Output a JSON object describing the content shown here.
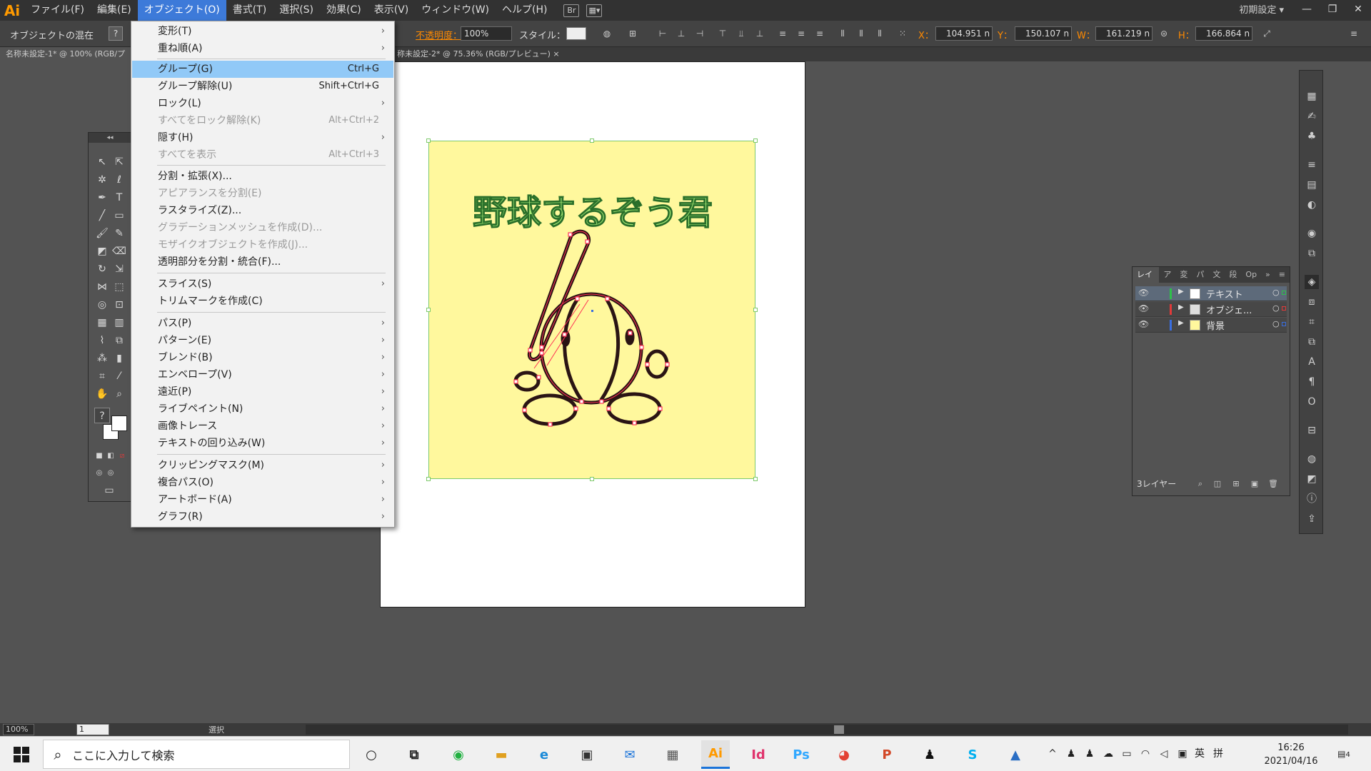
{
  "app": {
    "logo": "Ai",
    "workspace": "初期設定"
  },
  "menubar": {
    "items": [
      "ファイル(F)",
      "編集(E)",
      "オブジェクト(O)",
      "書式(T)",
      "選択(S)",
      "効果(C)",
      "表示(V)",
      "ウィンドウ(W)",
      "ヘルプ(H)"
    ],
    "active_index": 2
  },
  "window": {
    "minimize": "—",
    "restore": "❐",
    "close": "✕"
  },
  "control_bar": {
    "mixed_label": "オブジェクトの混在",
    "help": "?",
    "opacity_label": "不透明度：",
    "opacity_value": "100%",
    "style_label": "スタイル：",
    "x_label": "X：",
    "x_value": "104.951 n",
    "y_label": "Y：",
    "y_value": "150.107 n",
    "w_label": "W：",
    "w_value": "161.219 n",
    "h_label": "H：",
    "h_value": "166.864 n"
  },
  "tabs": [
    {
      "label": "名称未設定-1* @ 100% (RGB/プ"
    },
    {
      "label": "称未設定-2* @ 75.36% (RGB/プレビュー)  ×"
    }
  ],
  "artwork": {
    "title": "野球するぞう君",
    "colors": {
      "background": "#fff89d",
      "title_fill": "#a8eb77",
      "title_stroke": "#2a6f2a",
      "outline": "#2a1414",
      "path_points": "#ff3355",
      "selection": "#7ec96c"
    }
  },
  "object_menu": {
    "items": [
      {
        "label": "変形(T)",
        "shortcut": "",
        "submenu": true,
        "disabled": false
      },
      {
        "label": "重ね順(A)",
        "shortcut": "",
        "submenu": true,
        "disabled": false
      },
      {
        "label": "グループ(G)",
        "shortcut": "Ctrl+G",
        "submenu": false,
        "disabled": false,
        "highlighted": true
      },
      {
        "label": "グループ解除(U)",
        "shortcut": "Shift+Ctrl+G",
        "submenu": false,
        "disabled": false
      },
      {
        "label": "ロック(L)",
        "shortcut": "",
        "submenu": true,
        "disabled": false
      },
      {
        "label": "すべてをロック解除(K)",
        "shortcut": "Alt+Ctrl+2",
        "submenu": false,
        "disabled": true
      },
      {
        "label": "隠す(H)",
        "shortcut": "",
        "submenu": true,
        "disabled": false
      },
      {
        "label": "すべてを表示",
        "shortcut": "Alt+Ctrl+3",
        "submenu": false,
        "disabled": true
      },
      {
        "label": "分割・拡張(X)...",
        "shortcut": "",
        "submenu": false,
        "disabled": false
      },
      {
        "label": "アピアランスを分割(E)",
        "shortcut": "",
        "submenu": false,
        "disabled": true
      },
      {
        "label": "ラスタライズ(Z)...",
        "shortcut": "",
        "submenu": false,
        "disabled": false
      },
      {
        "label": "グラデーションメッシュを作成(D)...",
        "shortcut": "",
        "submenu": false,
        "disabled": true
      },
      {
        "label": "モザイクオブジェクトを作成(J)...",
        "shortcut": "",
        "submenu": false,
        "disabled": true
      },
      {
        "label": "透明部分を分割・統合(F)...",
        "shortcut": "",
        "submenu": false,
        "disabled": false
      },
      {
        "label": "スライス(S)",
        "shortcut": "",
        "submenu": true,
        "disabled": false
      },
      {
        "label": "トリムマークを作成(C)",
        "shortcut": "",
        "submenu": false,
        "disabled": false
      },
      {
        "label": "パス(P)",
        "shortcut": "",
        "submenu": true,
        "disabled": false
      },
      {
        "label": "パターン(E)",
        "shortcut": "",
        "submenu": true,
        "disabled": false
      },
      {
        "label": "ブレンド(B)",
        "shortcut": "",
        "submenu": true,
        "disabled": false
      },
      {
        "label": "エンベロープ(V)",
        "shortcut": "",
        "submenu": true,
        "disabled": false
      },
      {
        "label": "遠近(P)",
        "shortcut": "",
        "submenu": true,
        "disabled": false
      },
      {
        "label": "ライブペイント(N)",
        "shortcut": "",
        "submenu": true,
        "disabled": false
      },
      {
        "label": "画像トレース",
        "shortcut": "",
        "submenu": true,
        "disabled": false
      },
      {
        "label": "テキストの回り込み(W)",
        "shortcut": "",
        "submenu": true,
        "disabled": false
      },
      {
        "label": "クリッピングマスク(M)",
        "shortcut": "",
        "submenu": true,
        "disabled": false
      },
      {
        "label": "複合パス(O)",
        "shortcut": "",
        "submenu": true,
        "disabled": false
      },
      {
        "label": "アートボード(A)",
        "shortcut": "",
        "submenu": true,
        "disabled": false
      },
      {
        "label": "グラフ(R)",
        "shortcut": "",
        "submenu": true,
        "disabled": false
      }
    ]
  },
  "layers_panel": {
    "tabs": [
      "レイヤー",
      "ア",
      "変",
      "パ",
      "文",
      "段",
      "Op"
    ],
    "layers": [
      {
        "name": "テキスト",
        "color": "#2fc04a",
        "selected": true
      },
      {
        "name": "オブジェ...",
        "color": "#e23a3a",
        "selected": false
      },
      {
        "name": "背景",
        "color": "#3a6ee0",
        "selected": false
      }
    ],
    "count_label": "3レイヤー"
  },
  "status_bar": {
    "zoom": "100%",
    "page": "1",
    "status": "選択"
  },
  "taskbar": {
    "search_placeholder": "ここに入力して検索",
    "apps": [
      "Ai",
      "Id",
      "Ps"
    ],
    "ime_mode": "英",
    "ime_input": "拼",
    "time": "16:26",
    "date": "2021/04/16",
    "notifications": "4"
  }
}
